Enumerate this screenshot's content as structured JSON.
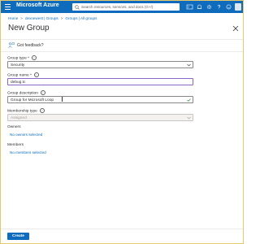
{
  "app": {
    "brand": "Microsoft Azure",
    "search_placeholder": "Search resources, services, and docs (G+/)",
    "accent_color": "#0f6cbd"
  },
  "breadcrumb": [
    "Home",
    "dexnewest | Groups",
    "Groups | All groups"
  ],
  "page": {
    "title": "New Group"
  },
  "feedback": {
    "label": "Got feedback?",
    "icon": "person-feedback-icon"
  },
  "form": {
    "group_type": {
      "label": "Group type",
      "required_mark": "*",
      "value": "Security"
    },
    "group_name": {
      "label": "Group name",
      "required_mark": "*",
      "value": "debug.tc"
    },
    "group_description": {
      "label": "Group description",
      "value": "Group for Microsoft Loop"
    },
    "membership_type": {
      "label": "Membership type",
      "value": "Assigned"
    },
    "owners": {
      "label": "Owners",
      "link": "No owners selected"
    },
    "members": {
      "label": "Members",
      "link": "No members selected"
    }
  },
  "footer": {
    "create_label": "Create"
  }
}
